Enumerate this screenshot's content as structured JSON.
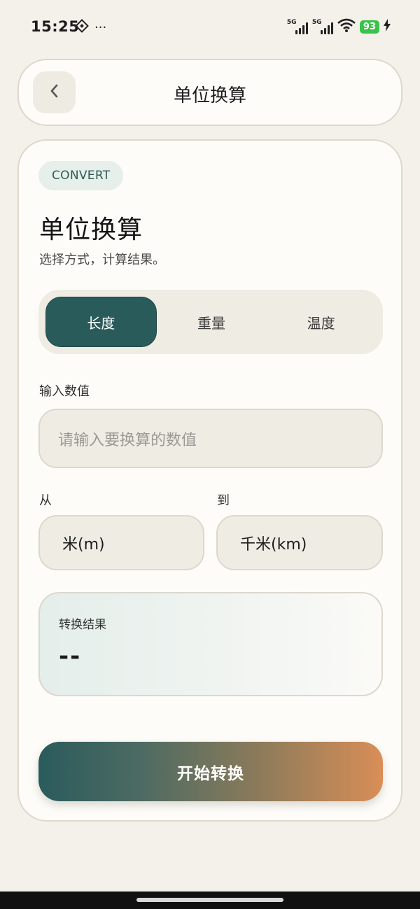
{
  "status_bar": {
    "time": "15:25",
    "signal_1": "5G",
    "signal_2": "5G",
    "battery": "93",
    "more": "···"
  },
  "header": {
    "title": "单位换算"
  },
  "main": {
    "tag": "CONVERT",
    "heading": "单位换算",
    "subtitle": "选择方式，计算结果。",
    "tabs": [
      {
        "label": "长度",
        "active": true
      },
      {
        "label": "重量",
        "active": false
      },
      {
        "label": "温度",
        "active": false
      }
    ],
    "input_label": "输入数值",
    "input_placeholder": "请输入要换算的数值",
    "from_label": "从",
    "to_label": "到",
    "from_unit": "米(m)",
    "to_unit": "千米(km)",
    "result_label": "转换结果",
    "result_value": "--",
    "start_button": "开始转换"
  },
  "colors": {
    "accent": "#295b5b",
    "background": "#f3f1ea",
    "card": "#fdfcf9",
    "button_gradient_end": "#d98e57"
  }
}
